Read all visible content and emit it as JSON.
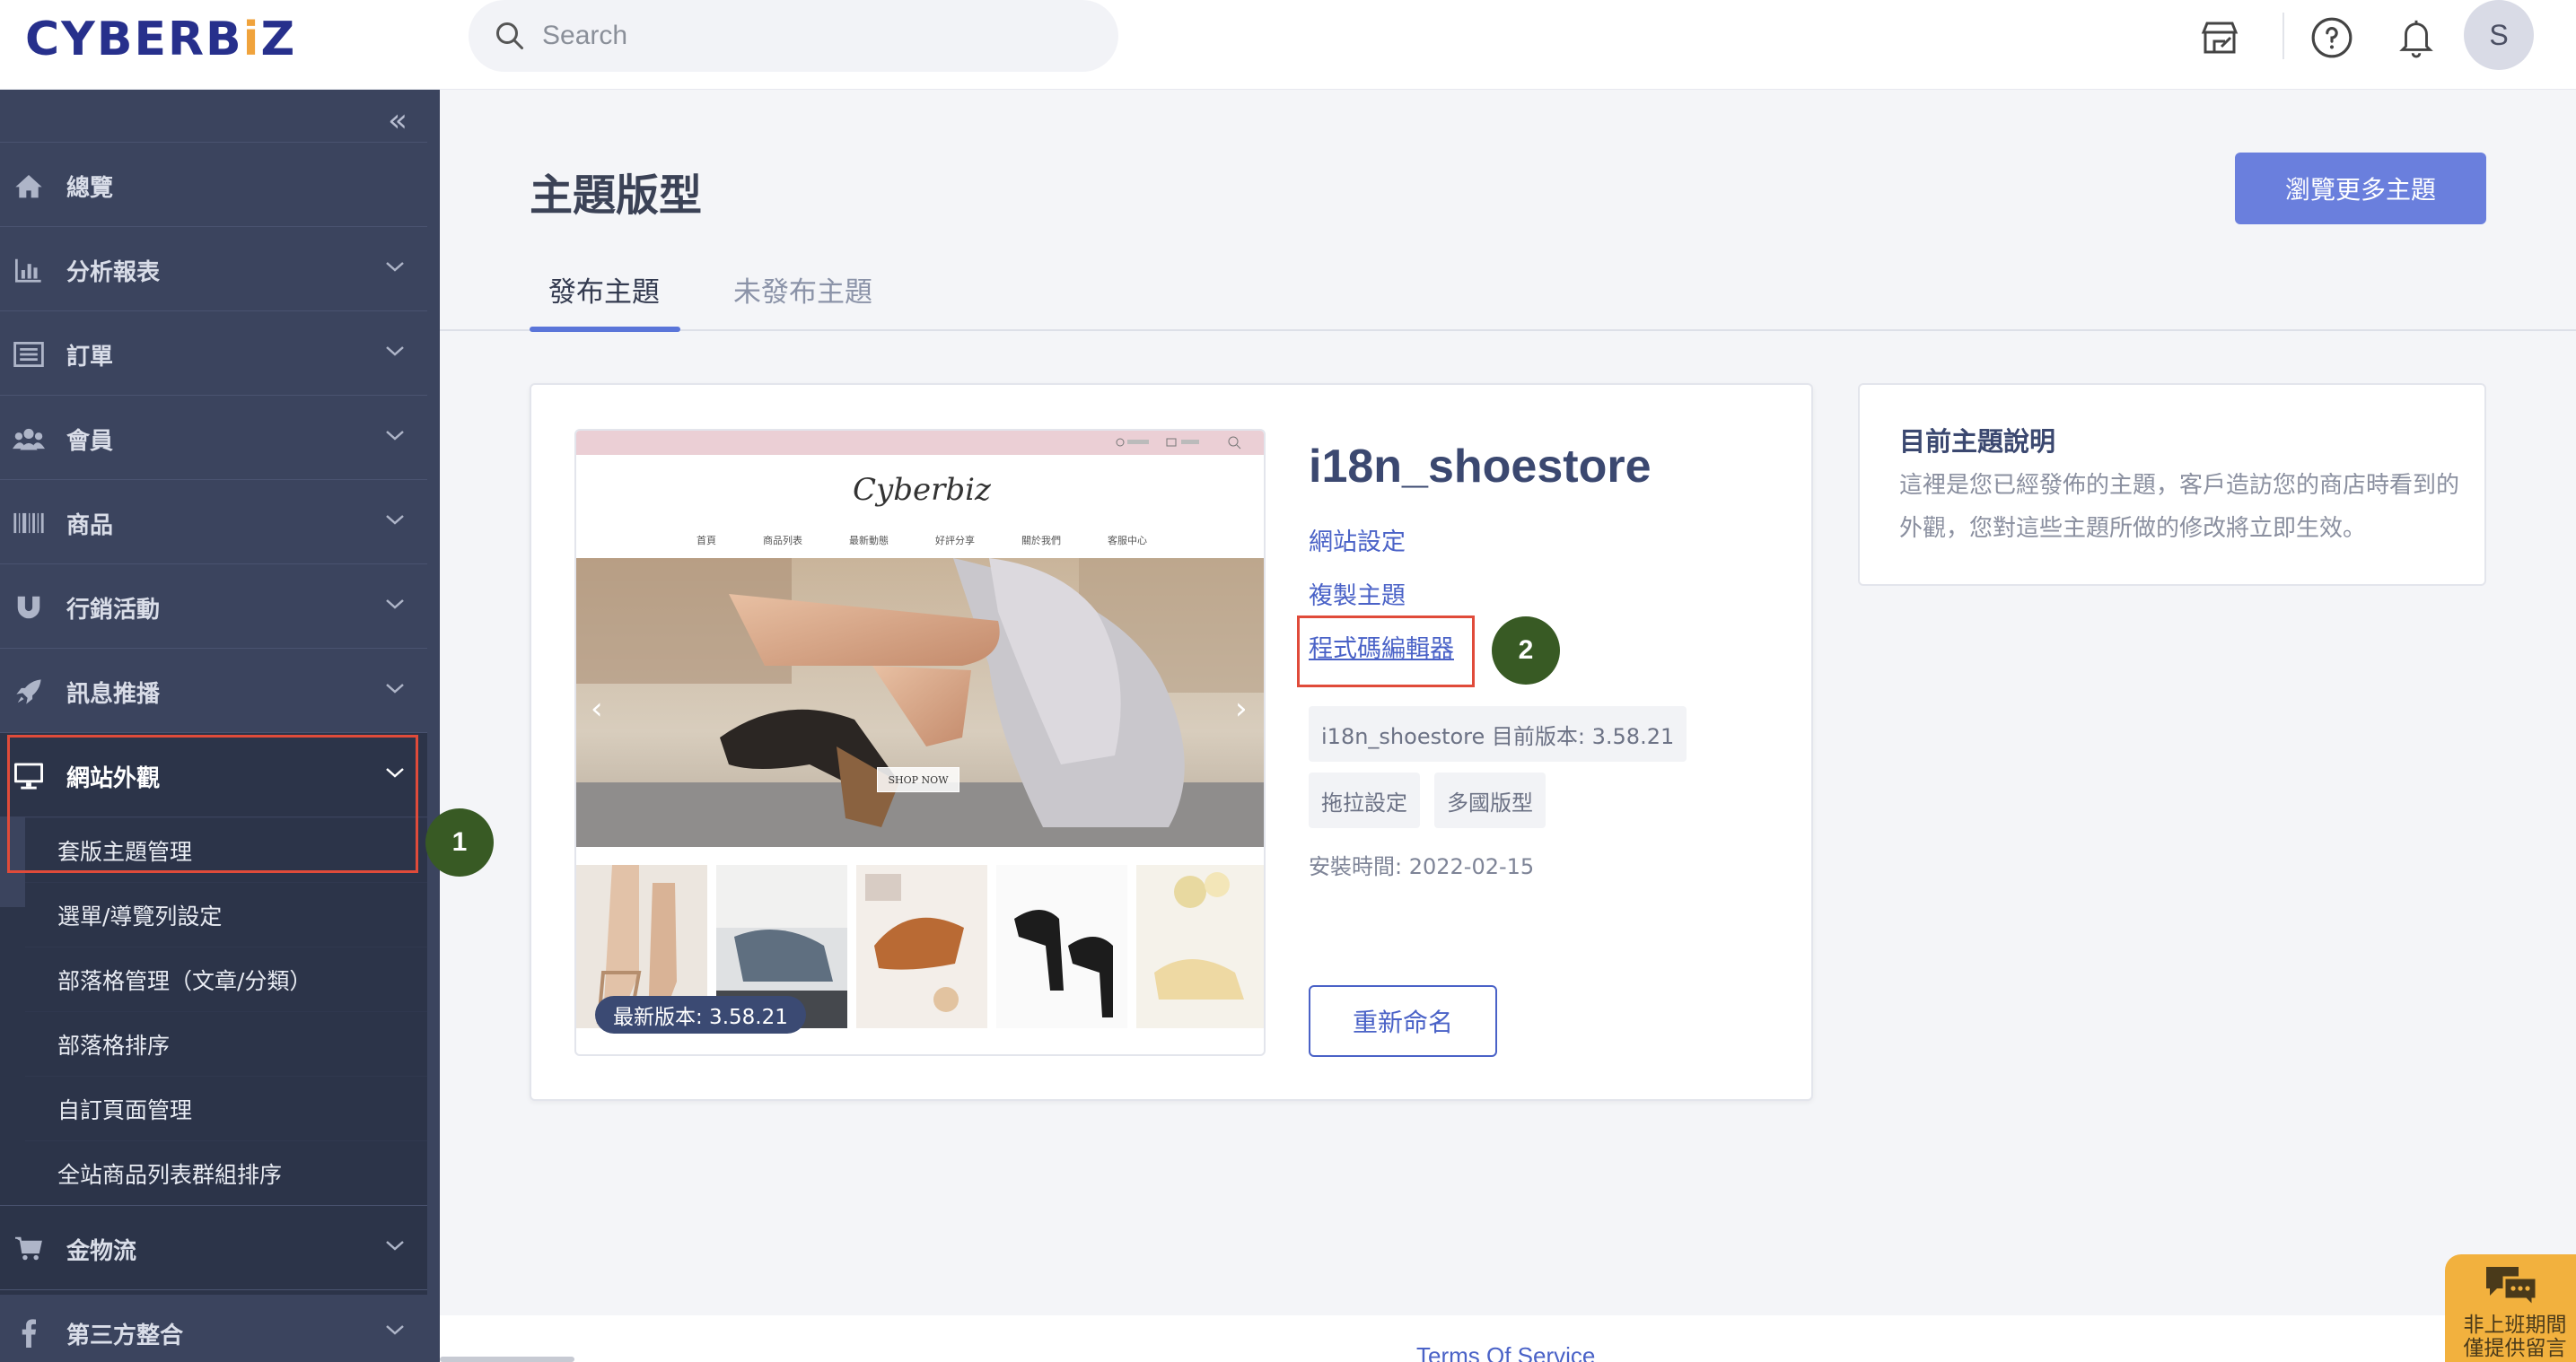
{
  "header": {
    "logo_main": "CYBERB",
    "logo_dot": "i",
    "logo_end": "Z",
    "search_placeholder": "Search",
    "avatar_initial": "S"
  },
  "sidebar": {
    "items": [
      {
        "label": "總覽",
        "icon": "home-icon"
      },
      {
        "label": "分析報表",
        "icon": "bar-chart-icon"
      },
      {
        "label": "訂單",
        "icon": "list-icon"
      },
      {
        "label": "會員",
        "icon": "users-icon"
      },
      {
        "label": "商品",
        "icon": "barcode-icon"
      },
      {
        "label": "行銷活動",
        "icon": "magnet-icon"
      },
      {
        "label": "訊息推播",
        "icon": "rocket-icon"
      },
      {
        "label": "網站外觀",
        "icon": "monitor-icon"
      },
      {
        "label": "金物流",
        "icon": "cart-icon"
      },
      {
        "label": "第三方整合",
        "icon": "facebook-icon"
      }
    ],
    "sub_items": [
      "套版主題管理",
      "選單/導覽列設定",
      "部落格管理（文章/分類）",
      "部落格排序",
      "自訂頁面管理",
      "全站商品列表群組排序"
    ]
  },
  "annotations": {
    "step1": "1",
    "step2": "2"
  },
  "main": {
    "title": "主題版型",
    "browse_button": "瀏覽更多主題",
    "tabs": [
      "發布主題",
      "未發布主題"
    ],
    "theme": {
      "name": "i18n_shoestore",
      "links": [
        "網站設定",
        "複製主題",
        "程式碼編輯器"
      ],
      "version_tag": "i18n_shoestore 目前版本: 3.58.21",
      "tags": [
        "拖拉設定",
        "多國版型"
      ],
      "install_time": "安裝時間: 2022-02-15",
      "rename_button": "重新命名",
      "latest_version": "最新版本: 3.58.21"
    },
    "info": {
      "title": "目前主題說明",
      "description": "這裡是您已經發佈的主題，客戶造訪您的商店時看到的外觀，您對這些主題所做的修改將立即生效。"
    }
  },
  "preview": {
    "logo": "Cyberbiz",
    "menu": [
      "首頁",
      "商品列表",
      "最新動態",
      "好評分享",
      "關於我們",
      "客服中心"
    ],
    "shop_now": "SHOP NOW"
  },
  "footer": {
    "link": "Terms Of Service"
  },
  "chat": {
    "line1": "非上班期間",
    "line2": "僅提供留言"
  },
  "colors": {
    "accent": "#5a75d9",
    "sidebar": "#3b445e",
    "highlight": "#e04b3a",
    "badge": "#385a24"
  }
}
